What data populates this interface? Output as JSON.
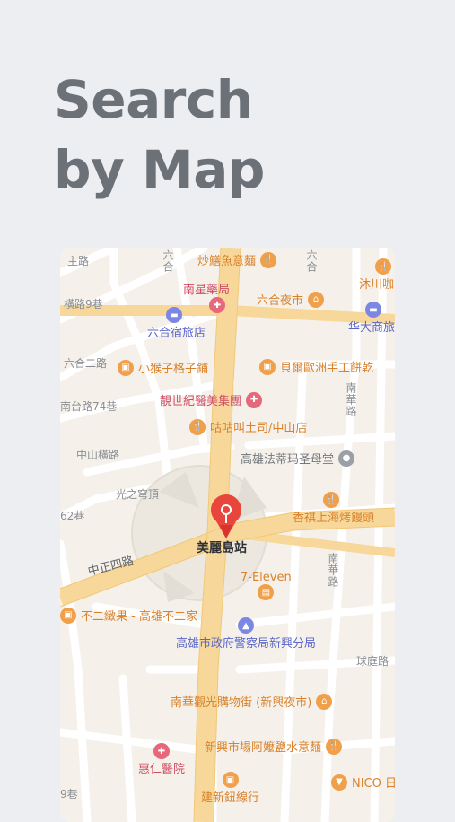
{
  "headline": {
    "line1": "Search",
    "line2": "by Map"
  },
  "colors": {
    "background": "#eceef1",
    "pin": "#e8453c",
    "road_major": "#f7d89a",
    "road_minor": "#ffffff"
  },
  "map": {
    "pin_icon": "map-pin-icon",
    "station": "美麗島站",
    "streets": {
      "zhongzheng": "中正四路",
      "zhongshan_heng": "中山橫路",
      "guangzhi": "光之穹頂",
      "liuhe_er": "六合二路",
      "road_74": "南台路74巷",
      "lane_62": "62巷",
      "lane_9": "9巷",
      "road_zhu": "主路",
      "road_hengjia": "橫路9巷",
      "liuhe_vert": "六合",
      "nanhua_vert1": "南華路",
      "nanhua_vert2": "南華路",
      "qiuliu": "球庭路",
      "right_top_vert": "六合"
    },
    "pois": [
      {
        "name": "炒鱔魚意麵",
        "icon": "restaurant-icon"
      },
      {
        "name": "南星藥局",
        "icon": "pharmacy-icon"
      },
      {
        "name": "六合夜市",
        "icon": "market-icon"
      },
      {
        "name": "沐川咖",
        "icon": "restaurant-icon"
      },
      {
        "name": "六合宿旅店",
        "icon": "hotel-icon"
      },
      {
        "name": "华大商旅",
        "icon": "hotel-icon"
      },
      {
        "name": "小猴子格子鋪",
        "icon": "shop-icon"
      },
      {
        "name": "貝爾歐洲手工餅乾",
        "icon": "shop-icon"
      },
      {
        "name": "靚世紀醫美集團",
        "icon": "clinic-icon"
      },
      {
        "name": "咕咕叫土司/中山店",
        "icon": "restaurant-icon"
      },
      {
        "name": "高雄法蒂玛圣母堂",
        "icon": "church-icon"
      },
      {
        "name": "香祺上海烤饅頭",
        "icon": "restaurant-icon"
      },
      {
        "name": "7-Eleven",
        "icon": "convenience-store-icon"
      },
      {
        "name": "不二緻果 - 高雄不二家",
        "icon": "shop-icon"
      },
      {
        "name": "高雄市政府警察局新興分局",
        "icon": "police-icon"
      },
      {
        "name": "南華觀光購物街 (新興夜市)",
        "icon": "market-icon"
      },
      {
        "name": "新興市場阿嬤鹽水意麵",
        "icon": "restaurant-icon"
      },
      {
        "name": "惠仁醫院",
        "icon": "hospital-icon"
      },
      {
        "name": "NICO 日",
        "icon": "clothing-icon"
      },
      {
        "name": "建新鈕線行",
        "icon": "shop-icon"
      }
    ]
  }
}
